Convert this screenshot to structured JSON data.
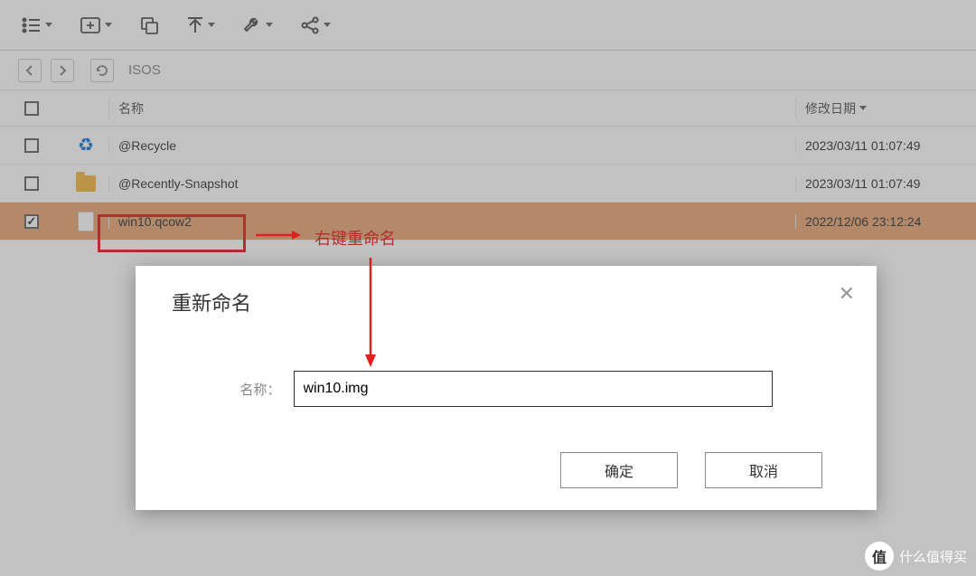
{
  "nav": {
    "path": "ISOS"
  },
  "columns": {
    "name": "名称",
    "date": "修改日期"
  },
  "rows": [
    {
      "name": "@Recycle",
      "date": "2023/03/11 01:07:49",
      "icon": "recycle",
      "checked": false
    },
    {
      "name": "@Recently-Snapshot",
      "date": "2023/03/11 01:07:49",
      "icon": "folder",
      "checked": false
    },
    {
      "name": "win10.qcow2",
      "date": "2022/12/06 23:12:24",
      "icon": "file",
      "checked": true
    }
  ],
  "annotation": {
    "text": "右键重命名"
  },
  "dialog": {
    "title": "重新命名",
    "field_label": "名称：",
    "value": "win10.img",
    "ok": "确定",
    "cancel": "取消"
  },
  "watermark": {
    "text": "什么值得买",
    "badge": "值"
  }
}
